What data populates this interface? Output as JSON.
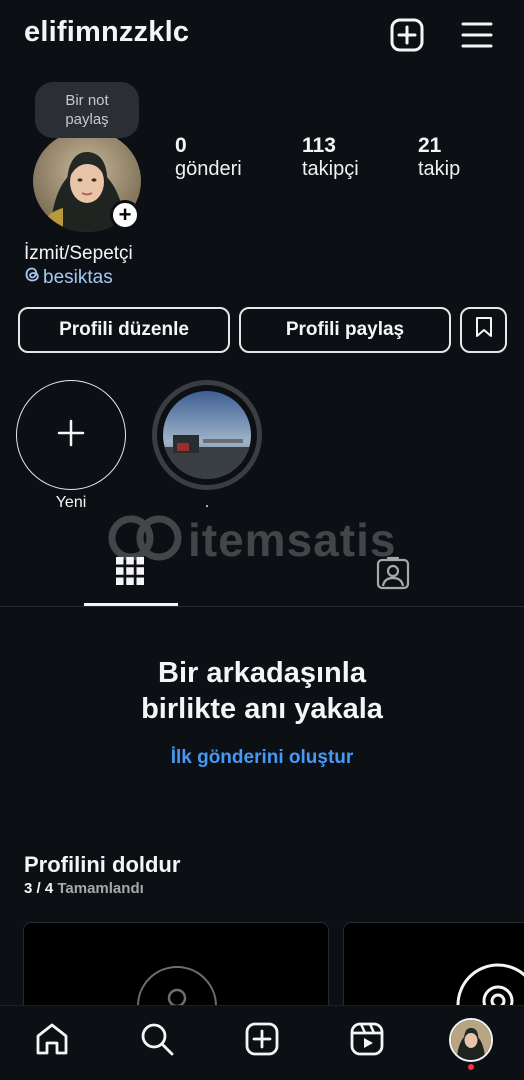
{
  "header": {
    "username": "elifimnzzklc",
    "icons": [
      "add-post-icon",
      "menu-icon"
    ]
  },
  "note": {
    "text_line1": "Bir not",
    "text_line2": "paylaş"
  },
  "stats": [
    {
      "value": "0",
      "label": "gönderi"
    },
    {
      "value": "113",
      "label": "takipçi"
    },
    {
      "value": "21",
      "label": "takip"
    }
  ],
  "bio": {
    "location": "İzmit/Sepetçi",
    "threads_handle": "besiktas"
  },
  "buttons": {
    "edit_profile": "Profili düzenle",
    "share_profile": "Profili paylaş"
  },
  "highlights": [
    {
      "label": "Yeni"
    },
    {
      "label": "."
    }
  ],
  "watermark": {
    "text": "itemsatis"
  },
  "empty_state": {
    "title_line1": "Bir arkadaşınla",
    "title_line2": "birlikte anı yakala",
    "cta": "İlk gönderini oluştur"
  },
  "profile_completion": {
    "title": "Profilini doldur",
    "progress": "3 / 4",
    "status": "Tamamlandı",
    "completed_fraction": 0.75
  },
  "nav": [
    "home-icon",
    "search-icon",
    "create-icon",
    "reels-icon",
    "profile-avatar"
  ],
  "colors": {
    "background": "#0c1014",
    "link": "#4599f5",
    "threads_link": "#a5c8f5",
    "notification_dot": "#ff3040"
  }
}
